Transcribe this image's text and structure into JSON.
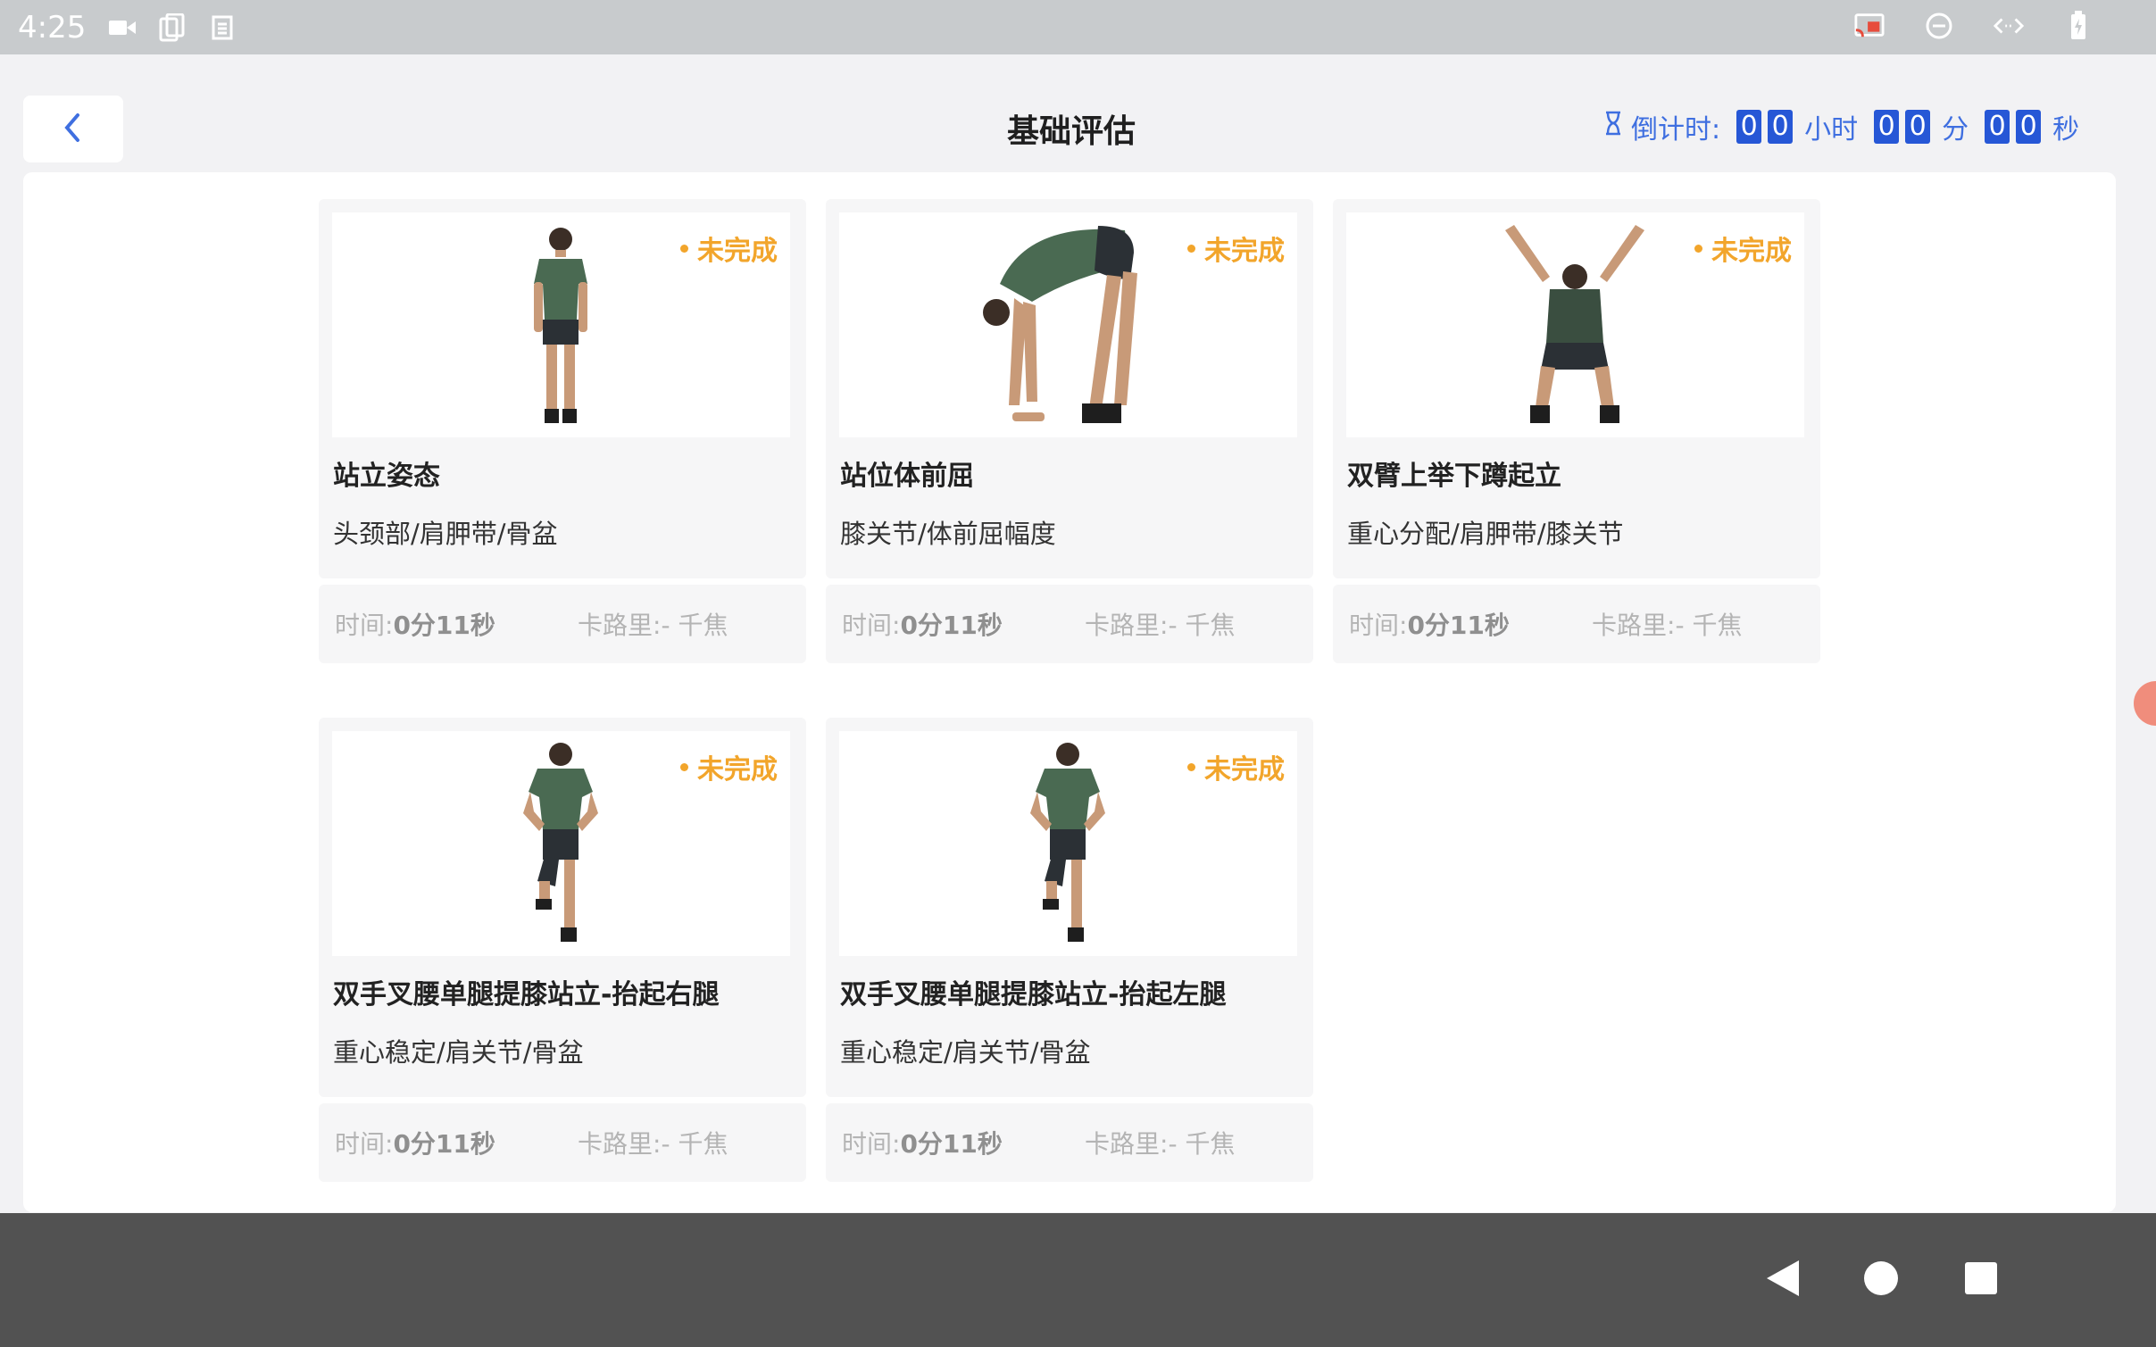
{
  "status_bar": {
    "time": "4:25",
    "left_icons": [
      "video-camera-icon",
      "copy-icon",
      "sim-icon"
    ],
    "right_icons": [
      "cast-icon",
      "do-not-disturb-icon",
      "code-arrows-icon",
      "battery-icon"
    ]
  },
  "header": {
    "title": "基础评估",
    "back_icon": "chevron-left-icon",
    "countdown": {
      "label": "倒计时:",
      "hours": [
        "0",
        "0"
      ],
      "hours_unit": "小时",
      "minutes": [
        "0",
        "0"
      ],
      "minutes_unit": "分",
      "seconds": [
        "0",
        "0"
      ],
      "seconds_unit": "秒"
    }
  },
  "cards": [
    {
      "status": "未完成",
      "title": "站立姿态",
      "subtitle": "头颈部/肩胛带/骨盆",
      "time_label": "时间:",
      "time_value": "0分11秒",
      "calorie_label": "卡路里:",
      "calorie_value": "- 千焦",
      "image": "standing-posture-figure"
    },
    {
      "status": "未完成",
      "title": "站位体前屈",
      "subtitle": "膝关节/体前屈幅度",
      "time_label": "时间:",
      "time_value": "0分11秒",
      "calorie_label": "卡路里:",
      "calorie_value": "- 千焦",
      "image": "forward-bend-figure"
    },
    {
      "status": "未完成",
      "title": "双臂上举下蹲起立",
      "subtitle": "重心分配/肩胛带/膝关节",
      "time_label": "时间:",
      "time_value": "0分11秒",
      "calorie_label": "卡路里:",
      "calorie_value": "- 千焦",
      "image": "overhead-squat-figure"
    },
    {
      "status": "未完成",
      "title": "双手叉腰单腿提膝站立-抬起右腿",
      "subtitle": "重心稳定/肩关节/骨盆",
      "time_label": "时间:",
      "time_value": "0分11秒",
      "calorie_label": "卡路里:",
      "calorie_value": "- 千焦",
      "image": "single-leg-stand-right-figure"
    },
    {
      "status": "未完成",
      "title": "双手叉腰单腿提膝站立-抬起左腿",
      "subtitle": "重心稳定/肩关节/骨盆",
      "time_label": "时间:",
      "time_value": "0分11秒",
      "calorie_label": "卡路里:",
      "calorie_value": "- 千焦",
      "image": "single-leg-stand-left-figure"
    }
  ],
  "nav_bar": {
    "buttons": [
      "back-triangle-icon",
      "home-circle-icon",
      "recents-square-icon"
    ]
  },
  "colors": {
    "accent_blue": "#2657d6",
    "status_orange": "#f2a52b",
    "shirt_green": "#4a6a52",
    "shorts_dark": "#2b3035"
  }
}
